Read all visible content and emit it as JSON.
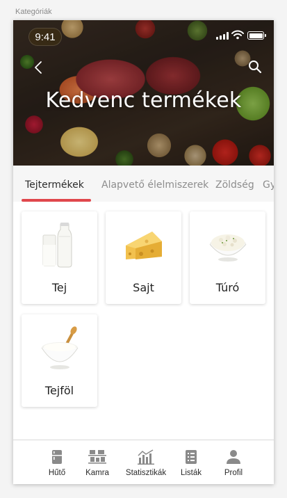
{
  "canvas_label": "Kategóriák",
  "status_bar": {
    "time": "9:41"
  },
  "header": {
    "title": "Kedvenc termékek"
  },
  "tabs": [
    {
      "label": "Tejtermékek",
      "active": true
    },
    {
      "label": "Alapvető élelmiszerek",
      "active": false
    },
    {
      "label": "Zöldség",
      "active": false
    },
    {
      "label": "Gy",
      "active": false
    }
  ],
  "products": [
    {
      "label": "Tej",
      "icon": "milk-icon"
    },
    {
      "label": "Sajt",
      "icon": "cheese-icon"
    },
    {
      "label": "Túró",
      "icon": "cottage-cheese-icon"
    },
    {
      "label": "Tejföl",
      "icon": "sour-cream-icon"
    }
  ],
  "bottom_nav": [
    {
      "label": "Hűtő",
      "icon": "fridge-icon"
    },
    {
      "label": "Kamra",
      "icon": "pantry-icon"
    },
    {
      "label": "Statisztikák",
      "icon": "statistics-icon"
    },
    {
      "label": "Listák",
      "icon": "list-icon"
    },
    {
      "label": "Profil",
      "icon": "profile-icon"
    }
  ],
  "colors": {
    "accent": "#e0474c",
    "tab_bar_bg": "#f6f6f6",
    "inactive_tab_text": "#8d8d8d",
    "nav_icon": "#8a8a8a"
  }
}
